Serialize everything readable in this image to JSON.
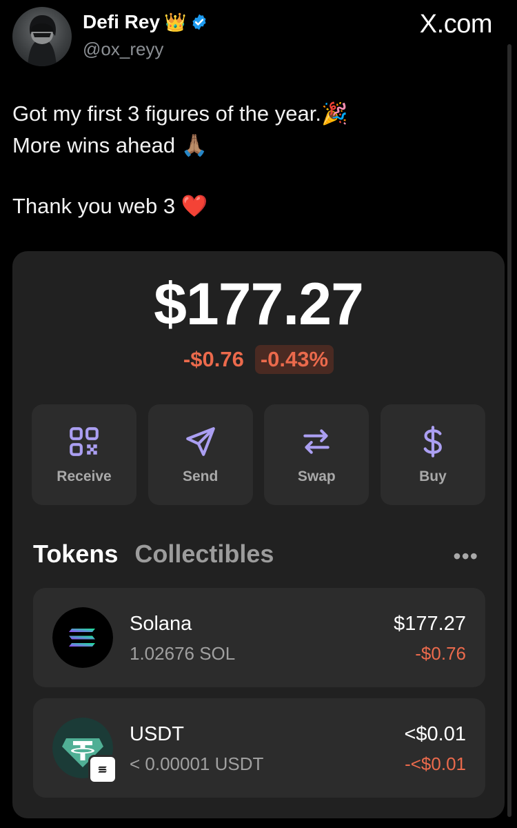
{
  "tweet": {
    "display_name": "Defi Rey",
    "name_emoji": "👑",
    "handle": "@ox_reyy",
    "site": "X.com",
    "lines": [
      "Got my first 3 figures of the year.🎉",
      "More wins ahead 🙏🏽",
      "Thank you web 3 ❤️"
    ]
  },
  "wallet": {
    "balance": "$177.27",
    "change_amount": "-$0.76",
    "change_percent": "-0.43%",
    "actions": [
      {
        "label": "Receive",
        "icon": "qr-code-icon"
      },
      {
        "label": "Send",
        "icon": "paper-plane-icon"
      },
      {
        "label": "Swap",
        "icon": "swap-arrows-icon"
      },
      {
        "label": "Buy",
        "icon": "dollar-icon"
      }
    ],
    "tabs": [
      "Tokens",
      "Collectibles"
    ],
    "more_icon": "more-horizontal-icon",
    "tokens": [
      {
        "name": "Solana",
        "amount": "1.02676 SOL",
        "value": "$177.27",
        "change": "-$0.76",
        "icon": "solana-logo-icon"
      },
      {
        "name": "USDT",
        "amount": "< 0.00001 USDT",
        "value": "<$0.01",
        "change": "-<$0.01",
        "icon": "tether-logo-icon"
      }
    ]
  },
  "colors": {
    "accent": "#ab9ff2",
    "negative": "#eb6a4c",
    "card_bg": "#212121",
    "button_bg": "#2c2c2c",
    "verified": "#1d9bf0"
  }
}
